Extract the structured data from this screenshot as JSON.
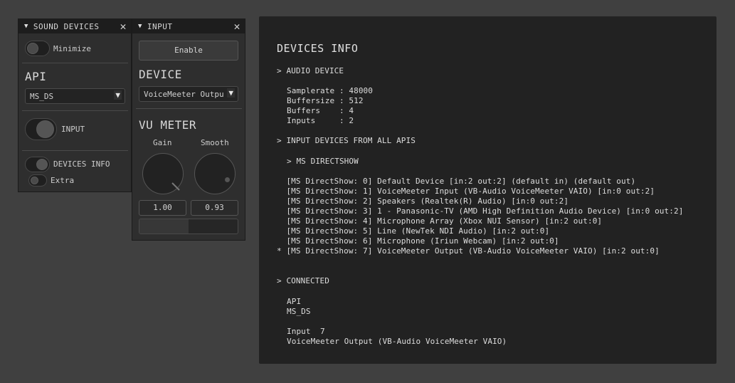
{
  "sound_panel": {
    "title": "SOUND DEVICES",
    "minimize_label": "Minimize",
    "api_heading": "API",
    "api_value": "MS_DS",
    "input_toggle_label": "INPUT",
    "devices_info_label": "DEVICES INFO",
    "extra_label": "Extra"
  },
  "input_panel": {
    "title": "INPUT",
    "enable_label": "Enable",
    "device_heading": "DEVICE",
    "device_value": "VoiceMeeter Output",
    "vu_heading": "VU METER",
    "gain_label": "Gain",
    "smooth_label": "Smooth",
    "gain_value": "1.00",
    "smooth_value": "0.93",
    "vu_level": 0.5
  },
  "info": {
    "title": "DEVICES INFO",
    "audio_device_header": "> AUDIO DEVICE",
    "samplerate": "Samplerate : 48000",
    "buffersize": "Buffersize : 512",
    "buffers": "Buffers    : 4",
    "inputs": "Inputs     : 2",
    "input_devices_header": "> INPUT DEVICES FROM ALL APIS",
    "ms_directshow_header": "> MS DIRECTSHOW",
    "devices": [
      "  [MS DirectShow: 0] Default Device [in:2 out:2] (default in) (default out)",
      "  [MS DirectShow: 1] VoiceMeeter Input (VB-Audio VoiceMeeter VAIO) [in:0 out:2]",
      "  [MS DirectShow: 2] Speakers (Realtek(R) Audio) [in:0 out:2]",
      "  [MS DirectShow: 3] 1 - Panasonic-TV (AMD High Definition Audio Device) [in:0 out:2]",
      "  [MS DirectShow: 4] Microphone Array (Xbox NUI Sensor) [in:2 out:0]",
      "  [MS DirectShow: 5] Line (NewTek NDI Audio) [in:2 out:0]",
      "  [MS DirectShow: 6] Microphone (Iriun Webcam) [in:2 out:0]",
      "* [MS DirectShow: 7] VoiceMeeter Output (VB-Audio VoiceMeeter VAIO) [in:2 out:0]"
    ],
    "connected_header": "> CONNECTED",
    "api_label": "API",
    "api_value": "MS_DS",
    "input_label": "Input  7",
    "input_device": "VoiceMeeter Output (VB-Audio VoiceMeeter VAIO)"
  }
}
